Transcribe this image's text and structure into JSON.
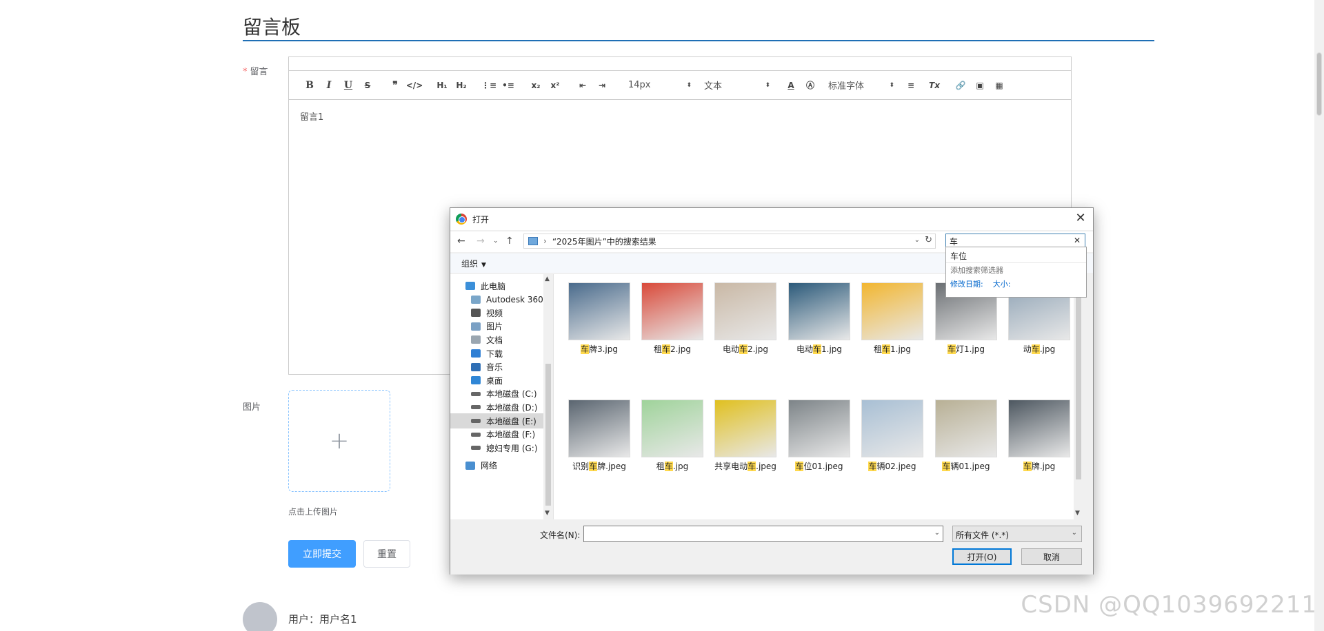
{
  "page": {
    "title": "留言板",
    "message_label": "留言",
    "image_label": "图片",
    "upload_tip": "点击上传图片",
    "submit_label": "立即提交",
    "reset_label": "重置",
    "user_line": "用户：用户名1",
    "watermark": "CSDN @QQ1039692211"
  },
  "editor": {
    "content": "留言1",
    "font_size": "14px",
    "block_type": "文本",
    "font_family": "标准字体",
    "toolbar_icons": [
      "bold-icon",
      "italic-icon",
      "underline-icon",
      "strike-icon",
      "quote-icon",
      "code-icon",
      "h1-icon",
      "h2-icon",
      "ordered-list-icon",
      "bullet-list-icon",
      "subscript-icon",
      "superscript-icon",
      "outdent-icon",
      "indent-icon",
      "font-color-icon",
      "background-color-icon",
      "align-icon",
      "clear-format-icon",
      "link-icon",
      "image-icon",
      "video-icon"
    ]
  },
  "dialog": {
    "title": "打开",
    "breadcrumb": "“2025年图片”中的搜索结果",
    "search_value": "车",
    "organize": "组织",
    "suggest": {
      "item": "车位",
      "add_filter": "添加搜索筛选器",
      "modified": "修改日期:",
      "size": "大小:"
    },
    "nav": [
      {
        "label": "此电脑",
        "icon": "computer-icon",
        "indent": 0
      },
      {
        "label": "Autodesk 360",
        "icon": "cloud-icon",
        "indent": 1
      },
      {
        "label": "视频",
        "icon": "video-folder-icon",
        "indent": 1
      },
      {
        "label": "图片",
        "icon": "pictures-folder-icon",
        "indent": 1
      },
      {
        "label": "文档",
        "icon": "documents-folder-icon",
        "indent": 1
      },
      {
        "label": "下载",
        "icon": "download-icon",
        "indent": 1
      },
      {
        "label": "音乐",
        "icon": "music-icon",
        "indent": 1
      },
      {
        "label": "桌面",
        "icon": "desktop-icon",
        "indent": 1
      },
      {
        "label": "本地磁盘 (C:)",
        "icon": "drive-icon",
        "indent": 1
      },
      {
        "label": "本地磁盘 (D:)",
        "icon": "drive-icon",
        "indent": 1
      },
      {
        "label": "本地磁盘 (E:)",
        "icon": "drive-icon",
        "indent": 1,
        "selected": true
      },
      {
        "label": "本地磁盘 (F:)",
        "icon": "drive-icon",
        "indent": 1
      },
      {
        "label": "媳妇专用 (G:)",
        "icon": "drive-icon",
        "indent": 1
      },
      {
        "label": "网络",
        "icon": "network-icon",
        "indent": 0
      }
    ],
    "files": [
      {
        "pre": "",
        "hl": "车",
        "post": "牌3.jpg",
        "color": "#4a6b8c"
      },
      {
        "pre": "租",
        "hl": "车",
        "post": "2.jpg",
        "color": "#d94a3a"
      },
      {
        "pre": "电动",
        "hl": "车",
        "post": "2.jpg",
        "color": "#c9b8a5"
      },
      {
        "pre": "电动",
        "hl": "车",
        "post": "1.jpg",
        "color": "#2c5a7a"
      },
      {
        "pre": "租",
        "hl": "车",
        "post": "1.jpg",
        "color": "#f2b630"
      },
      {
        "pre": "",
        "hl": "车",
        "post": "灯1.jpg",
        "color": "#6b6f73"
      },
      {
        "pre": "动",
        "hl": "车",
        "post": ".jpg",
        "color": "#8fa3b5"
      },
      {
        "pre": "识别",
        "hl": "车",
        "post": "牌.jpeg",
        "color": "#5a6570"
      },
      {
        "pre": "租",
        "hl": "车",
        "post": ".jpg",
        "color": "#9fd39a"
      },
      {
        "pre": "共享电动",
        "hl": "车",
        "post": ".jpeg",
        "color": "#e0c020"
      },
      {
        "pre": "",
        "hl": "车",
        "post": "位01.jpeg",
        "color": "#7d8488"
      },
      {
        "pre": "",
        "hl": "车",
        "post": "辆02.jpeg",
        "color": "#a8bfd4"
      },
      {
        "pre": "",
        "hl": "车",
        "post": "辆01.jpeg",
        "color": "#b8b095"
      },
      {
        "pre": "",
        "hl": "车",
        "post": "牌.jpg",
        "color": "#4d5760"
      }
    ],
    "filename_label": "文件名(N):",
    "filename_value": "",
    "filetype": "所有文件 (*.*)",
    "open_label": "打开(O)",
    "cancel_label": "取消"
  }
}
